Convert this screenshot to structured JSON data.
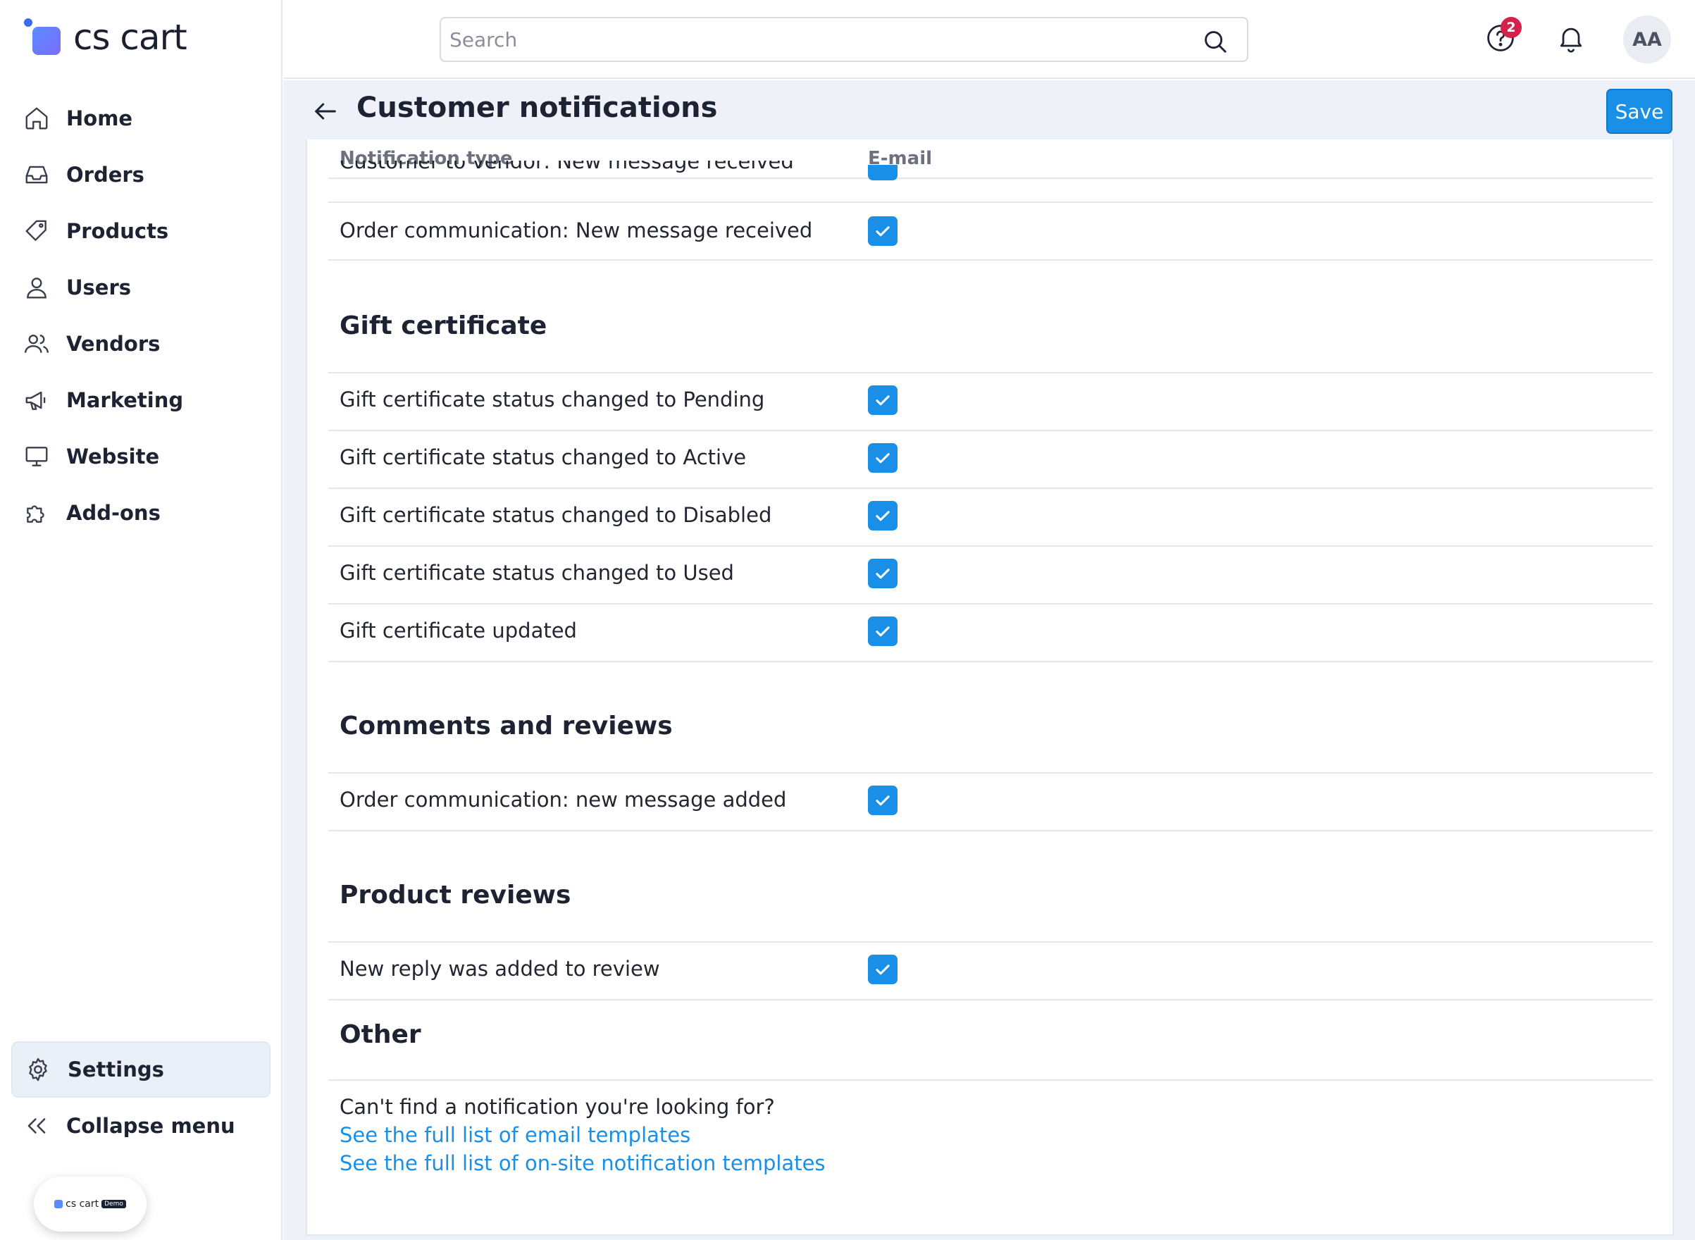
{
  "app": {
    "logo_text": "cs cart",
    "demo_logo_text": "cs cart",
    "demo_tag": "Demo"
  },
  "sidebar": {
    "items": [
      {
        "label": "Home",
        "icon": "home-icon"
      },
      {
        "label": "Orders",
        "icon": "inbox-icon"
      },
      {
        "label": "Products",
        "icon": "tag-icon"
      },
      {
        "label": "Users",
        "icon": "user-icon"
      },
      {
        "label": "Vendors",
        "icon": "users-icon"
      },
      {
        "label": "Marketing",
        "icon": "megaphone-icon"
      },
      {
        "label": "Website",
        "icon": "monitor-icon"
      },
      {
        "label": "Add-ons",
        "icon": "puzzle-icon"
      }
    ],
    "settings_label": "Settings",
    "collapse_label": "Collapse menu"
  },
  "topbar": {
    "search_placeholder": "Search",
    "help_badge": "2",
    "avatar_initials": "AA"
  },
  "header": {
    "title": "Customer notifications",
    "save_label": "Save"
  },
  "table": {
    "col_type": "Notification type",
    "col_email": "E-mail",
    "clipped_row": "Customer to vendor: New message received",
    "top_rows": [
      {
        "label": "Order communication: New message received",
        "email": true
      }
    ],
    "sections": [
      {
        "title": "Gift certificate",
        "rows": [
          {
            "label": "Gift certificate status changed to Pending",
            "email": true
          },
          {
            "label": "Gift certificate status changed to Active",
            "email": true
          },
          {
            "label": "Gift certificate status changed to Disabled",
            "email": true
          },
          {
            "label": "Gift certificate status changed to Used",
            "email": true
          },
          {
            "label": "Gift certificate updated",
            "email": true
          }
        ]
      },
      {
        "title": "Comments and reviews",
        "rows": [
          {
            "label": "Order communication: new message added",
            "email": true
          }
        ]
      },
      {
        "title": "Product reviews",
        "rows": [
          {
            "label": "New reply was added to review",
            "email": true
          }
        ]
      }
    ]
  },
  "other": {
    "title": "Other",
    "question": "Can't find a notification you're looking for?",
    "link_email": "See the full list of email templates",
    "link_onsite": "See the full list of on-site notification templates"
  },
  "colors": {
    "accent": "#1a8fe8",
    "badge": "#d6214b",
    "title_bar_bg": "#eef2f8"
  }
}
